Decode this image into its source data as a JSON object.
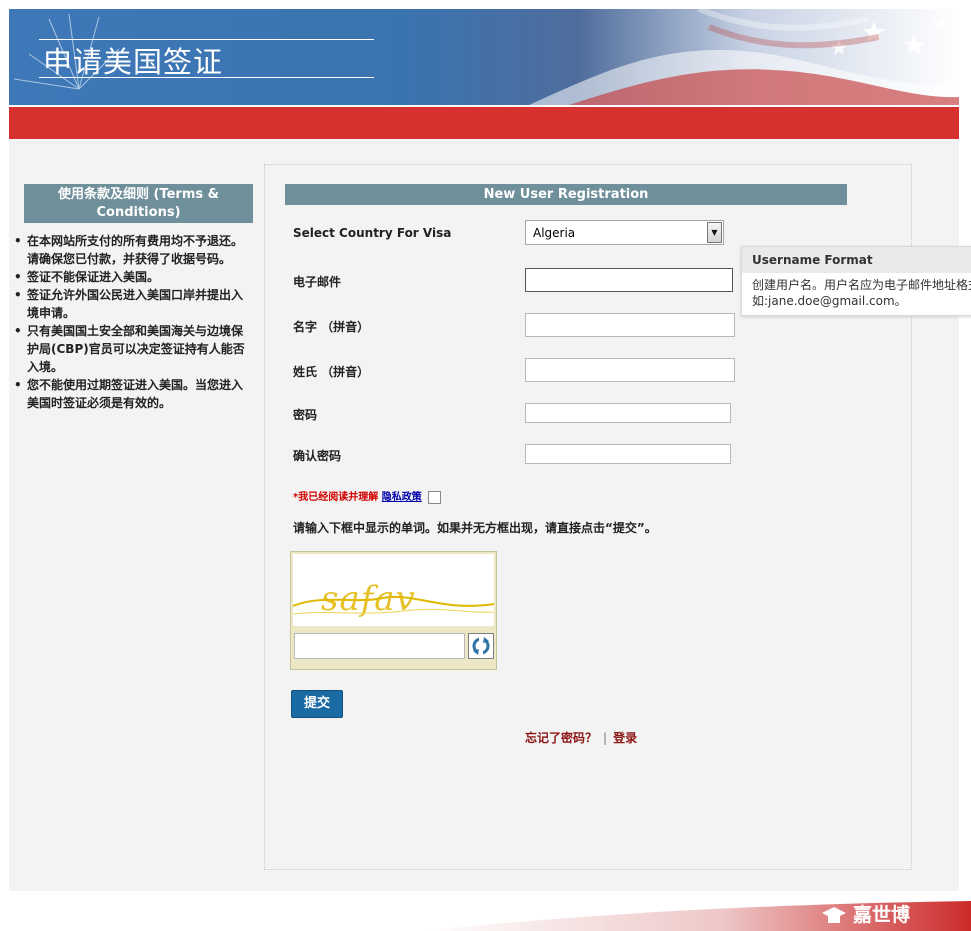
{
  "header": {
    "title": "申请美国签证"
  },
  "sidebar": {
    "terms_title": "使用条款及细则 (Terms & Conditions)",
    "items": [
      "在本网站所支付的所有费用均不予退还。请确保您已付款，并获得了收据号码。",
      "签证不能保证进入美国。",
      "签证允许外国公民进入美国口岸并提出入境申请。",
      "只有美国国土安全部和美国海关与边境保护局(CBP)官员可以决定签证持有人能否入境。",
      "您不能使用过期签证进入美国。当您进入美国时签证必须是有效的。"
    ]
  },
  "form": {
    "heading": "New User Registration",
    "country_label": "Select Country For Visa",
    "country_value": "Algeria",
    "email_label": "电子邮件",
    "given_name_label": "名字 （拼音）",
    "surname_label": "姓氏 （拼音）",
    "password_label": "密码",
    "confirm_password_label": "确认密码",
    "privacy_required": "*我已经阅读并理解",
    "privacy_link": "隐私政策",
    "captcha_instruction": "请输入下框中显示的单词。如果并无方框出现，请直接点击“提交”。",
    "captcha_text": "safav",
    "submit_label": "提交",
    "forgot_password": "忘记了密码？",
    "separator": "|",
    "login": "登录"
  },
  "tooltip": {
    "title": "Username Format",
    "line1": "创建用户名。用户名应为电子邮件地址格式",
    "line2": "如:jane.doe@gmail.com。"
  },
  "footer": {
    "logo_text": "嘉世博"
  },
  "colors": {
    "header_blue": "#3f78b8",
    "red_bar": "#d6302f",
    "section_head": "#6f8f9b",
    "submit_button": "#1a6aa4",
    "link_dark_red": "#8b1414"
  }
}
